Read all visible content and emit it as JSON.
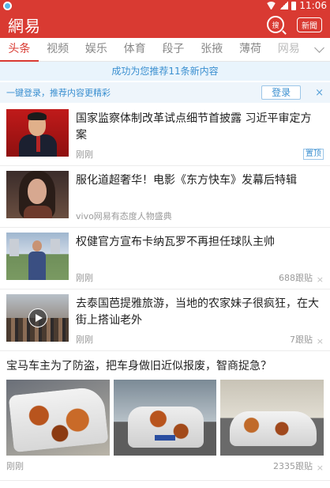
{
  "status": {
    "time": "11:06"
  },
  "header": {
    "logo": "網易",
    "search_label": "搜",
    "news_label": "新聞"
  },
  "tabs": [
    "头条",
    "视频",
    "娱乐",
    "体育",
    "段子",
    "张掖",
    "薄荷",
    "网易"
  ],
  "banner": "成功为您推荐11条新内容",
  "login": {
    "tip": "一键登录，推荐内容更精彩",
    "button": "登录",
    "close": "×"
  },
  "feed": [
    {
      "title": "国家监察体制改革试点细节首披露 习近平审定方案",
      "meta": "刚刚",
      "tag": "置顶"
    },
    {
      "title": "服化道超奢华！电影《东方快车》发幕后特辑",
      "meta": "vivo网易有态度人物盛典"
    },
    {
      "title": "权健官方宣布卡纳瓦罗不再担任球队主帅",
      "meta": "刚刚",
      "reply": "688跟贴",
      "close": "×"
    },
    {
      "title": "去泰国芭提雅旅游，当地的农家妹子很疯狂，在大街上搭讪老外",
      "meta": "刚刚",
      "reply": "7跟贴",
      "close": "×"
    }
  ],
  "gallery": {
    "title": "宝马车主为了防盗，把车身做旧近似报废，智商捉急？",
    "meta": "刚刚",
    "reply": "2335跟贴",
    "close": "×"
  }
}
